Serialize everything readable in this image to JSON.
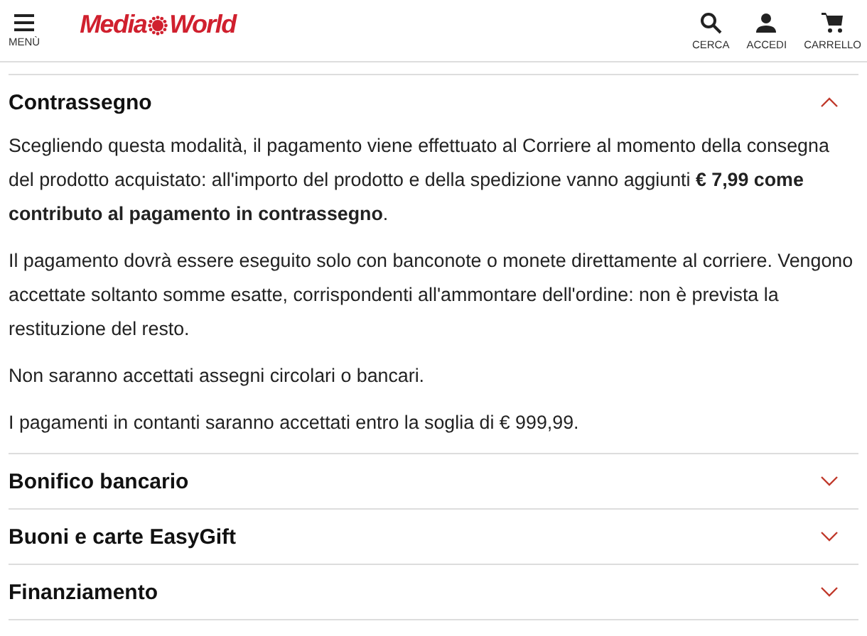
{
  "header": {
    "menu_label": "MENÙ",
    "logo": [
      "Media",
      "World"
    ],
    "actions": [
      {
        "kind": "search",
        "label": "CERCA"
      },
      {
        "kind": "user",
        "label": "ACCEDI"
      },
      {
        "kind": "cart",
        "label": "CARRELLO"
      }
    ]
  },
  "sections": [
    {
      "title": "Contrassegno",
      "expanded": true,
      "paragraphs": [
        "Scegliendo questa modalità, il pagamento viene effettuato al Corriere al momento della consegna del prodotto acquistato: all'importo del prodotto e della spedizione vanno aggiunti **€ 7,99 come contributo al pagamento in contrassegno**.",
        "Il pagamento dovrà essere eseguito solo con banconote o monete direttamente al corriere. Vengono accettate soltanto somme esatte, corrispondenti all'ammontare dell'ordine: non è prevista la restituzione del resto.",
        "Non saranno accettati assegni circolari o bancari.",
        "I pagamenti in contanti saranno accettati entro la soglia di € 999,99."
      ]
    },
    {
      "title": "Bonifico bancario",
      "expanded": false
    },
    {
      "title": "Buoni e carte EasyGift",
      "expanded": false
    },
    {
      "title": "Finanziamento",
      "expanded": false
    }
  ]
}
